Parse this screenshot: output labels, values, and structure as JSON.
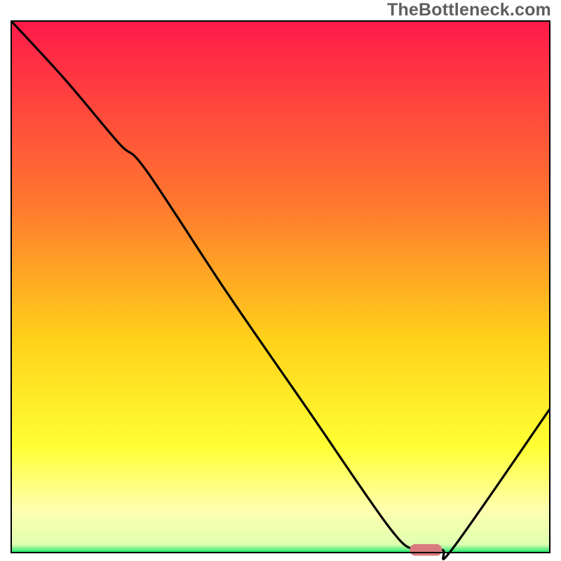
{
  "watermark": "TheBottleneck.com",
  "colors": {
    "gradient_top": "#ff1a4a",
    "gradient_mid1": "#ff6a2e",
    "gradient_mid2": "#ffd21a",
    "gradient_mid3": "#ffff33",
    "gradient_lightband": "#ffffb0",
    "gradient_green": "#17e86b",
    "curve_stroke": "#000000",
    "marker_fill": "#d97a7f",
    "frame_stroke": "#000000"
  },
  "chart_data": {
    "type": "line",
    "title": "",
    "xlabel": "",
    "ylabel": "",
    "xlim": [
      0,
      100
    ],
    "ylim": [
      0,
      100
    ],
    "series": [
      {
        "name": "bottleneck-curve",
        "x": [
          0,
          10,
          20,
          25,
          40,
          55,
          70,
          75,
          80,
          82,
          100
        ],
        "y": [
          100,
          89,
          77,
          72,
          49,
          27,
          5,
          0.5,
          0.5,
          0.8,
          27
        ]
      }
    ],
    "marker": {
      "name": "optimal-range",
      "x_center": 77,
      "y": 0.5,
      "width": 6,
      "height": 2.2
    },
    "background": {
      "type": "vertical-gradient",
      "stops": [
        {
          "offset": 0.0,
          "color": "#ff1a4a"
        },
        {
          "offset": 0.35,
          "color": "#ff7a2e"
        },
        {
          "offset": 0.6,
          "color": "#ffd21a"
        },
        {
          "offset": 0.8,
          "color": "#ffff33"
        },
        {
          "offset": 0.92,
          "color": "#ffffb0"
        },
        {
          "offset": 0.985,
          "color": "#dfffb0"
        },
        {
          "offset": 1.0,
          "color": "#17e86b"
        }
      ]
    }
  }
}
